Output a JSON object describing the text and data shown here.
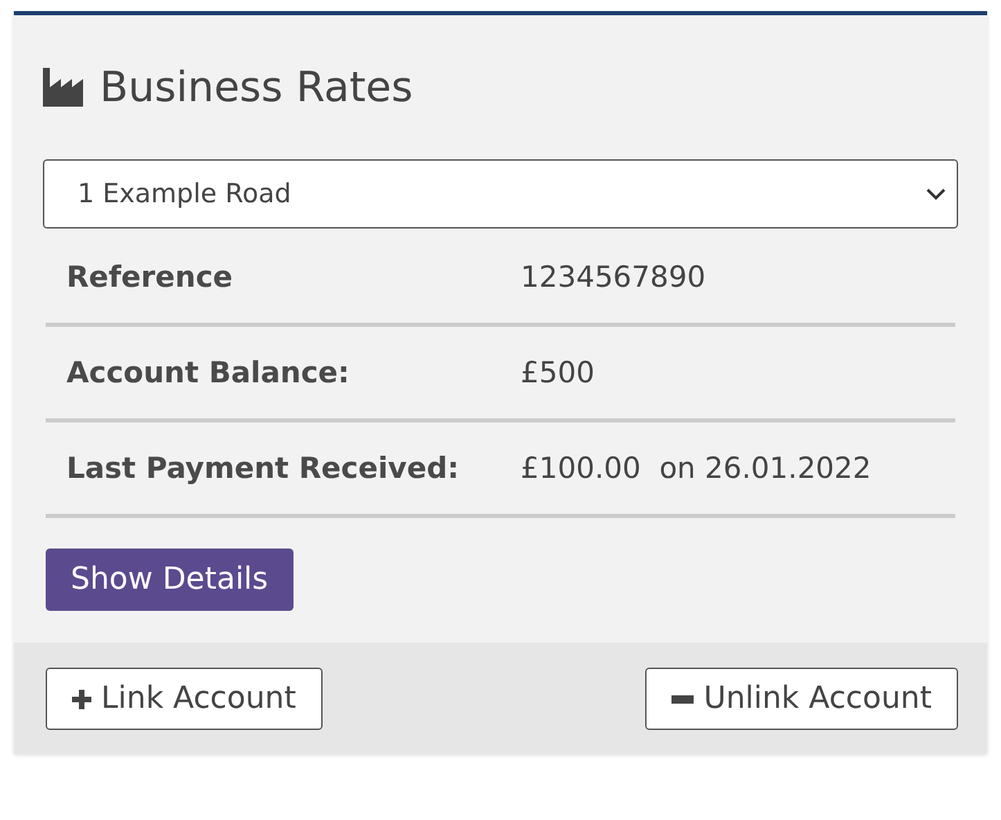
{
  "card": {
    "title": "Business Rates",
    "property_select": {
      "value": "1 Example Road"
    },
    "details": [
      {
        "label": "Reference",
        "value": "1234567890"
      },
      {
        "label": "Account Balance:",
        "value": "£500"
      },
      {
        "label": "Last Payment Received:",
        "value": "£100.00  on 26.01.2022"
      }
    ],
    "show_details_button": "Show Details",
    "footer_buttons": [
      {
        "kind": "link",
        "label": "Link Account"
      },
      {
        "kind": "unlink",
        "label": "Unlink Account"
      }
    ]
  }
}
